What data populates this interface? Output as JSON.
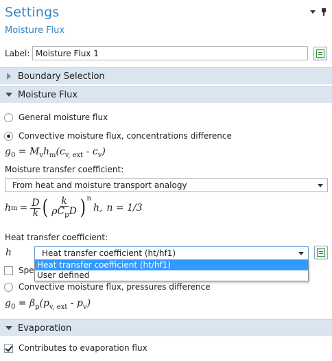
{
  "header": {
    "title": "Settings",
    "subtitle": "Moisture Flux"
  },
  "label_field": {
    "label": "Label:",
    "value": "Moisture Flux 1"
  },
  "sections": {
    "boundary_selection": "Boundary Selection",
    "moisture_flux": "Moisture Flux",
    "evaporation": "Evaporation"
  },
  "moisture_flux": {
    "radio_general": "General moisture flux",
    "radio_convective_conc": "Convective moisture flux, concentrations difference",
    "eq1": {
      "lhs": "g",
      "lhs_sub": "0",
      "text": "= M",
      "sub_v": "v",
      "h": "h",
      "sub_m": "m",
      "open": "(c",
      "sub_ext": "v, ext",
      "minus": " - c",
      "sub_v2": "v",
      "close": ")"
    },
    "mtc_label": "Moisture transfer coefficient:",
    "mtc_select_value": "From heat and moisture transport analogy",
    "eq2": {
      "lhs": "h",
      "lhs_sub": "m",
      "eq": "=",
      "num1": "D",
      "den1": "k",
      "num2": "k",
      "den2": "ρC",
      "den2_sub": "p",
      "den2_tail": "D",
      "exp": "n",
      "tail": "h,",
      "n_eq": "n = 1/3"
    },
    "htc_label": "Heat transfer coefficient:",
    "htc_symbol": "h",
    "htc_select_value": "Heat transfer coefficient (ht/hf1)",
    "htc_options": [
      "Heat transfer coefficient (ht/hf1)",
      "User defined"
    ],
    "specify_partial": "Speci",
    "radio_convective_pres": "Convective moisture flux, pressures difference",
    "eq3": {
      "lhs": "g",
      "lhs_sub": "0",
      "text": "= β",
      "sub_p": "p",
      "open": "(p",
      "sub_ext": "v, ext",
      "minus": " - p",
      "sub_v": "v",
      "close": ")"
    }
  },
  "evaporation": {
    "checkbox_label": "Contributes to evaporation flux",
    "checked": true
  },
  "icons": [
    "panel-menu-icon",
    "pin-icon",
    "expand-right-icon",
    "collapse-down-icon",
    "chevron-down-icon",
    "label-tool-icon",
    "variable-tool-icon"
  ]
}
